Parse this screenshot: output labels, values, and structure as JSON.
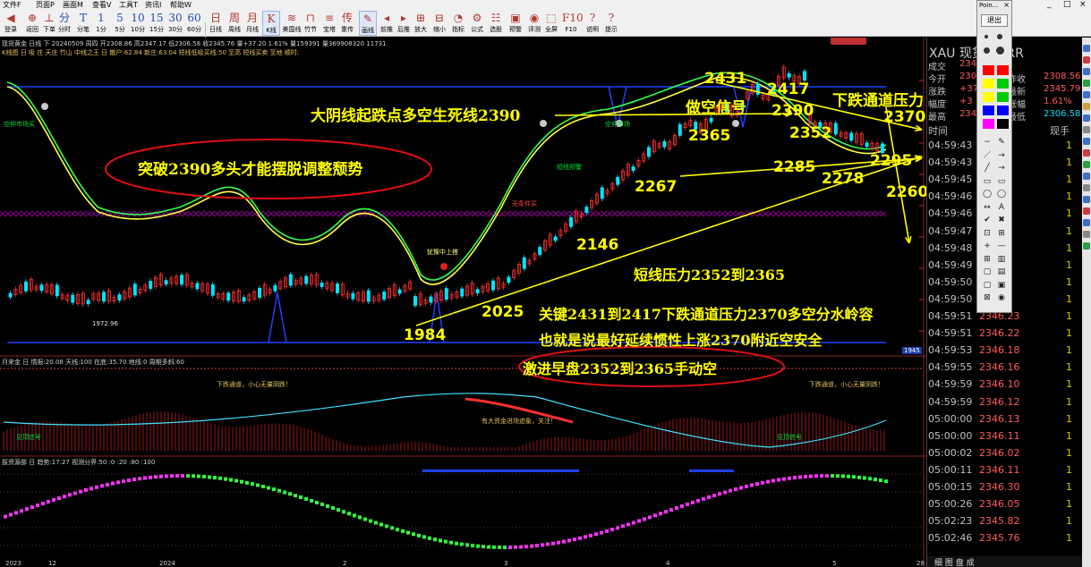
{
  "menu": {
    "items": [
      "文件F",
      "页面P",
      "画面M",
      "查看V",
      "工具T",
      "资讯I",
      "帮助W"
    ],
    "window_controls": [
      "_",
      "□",
      "×"
    ]
  },
  "toolbar": {
    "buttons": [
      {
        "glyph": "◀",
        "label": "登录"
      },
      {
        "glyph": "⊕",
        "label": "返回"
      },
      {
        "glyph": "⊥",
        "label": "下单"
      },
      {
        "glyph": "分",
        "label": "分时"
      },
      {
        "glyph": "T",
        "label": "分笔"
      },
      {
        "glyph": "1",
        "label": "1分"
      },
      {
        "glyph": "5",
        "label": "5分"
      },
      {
        "glyph": "10",
        "label": "10分"
      },
      {
        "glyph": "15",
        "label": "15分"
      },
      {
        "glyph": "30",
        "label": "30分"
      },
      {
        "glyph": "60",
        "label": "60分"
      },
      {
        "glyph": "日",
        "label": "日线"
      },
      {
        "glyph": "周",
        "label": "周线"
      },
      {
        "glyph": "月",
        "label": "月线"
      },
      {
        "glyph": "K",
        "label": "K线"
      },
      {
        "glyph": "≋",
        "label": "美国线"
      },
      {
        "glyph": "⊓",
        "label": "竹节"
      },
      {
        "glyph": "≡",
        "label": "宝塔"
      },
      {
        "glyph": "传",
        "label": "重传"
      },
      {
        "glyph": "✎",
        "label": "画线"
      },
      {
        "glyph": "◂",
        "label": "前推"
      },
      {
        "glyph": "▸",
        "label": "后推"
      },
      {
        "glyph": "⊞",
        "label": "放大"
      },
      {
        "glyph": "⊟",
        "label": "缩小"
      },
      {
        "glyph": "◔",
        "label": "指标"
      },
      {
        "glyph": "⚙",
        "label": "公式"
      },
      {
        "glyph": "☷",
        "label": "选股"
      },
      {
        "glyph": "▣",
        "label": "预警"
      },
      {
        "glyph": "◉",
        "label": "评测"
      },
      {
        "glyph": "⬚",
        "label": "全屏"
      },
      {
        "glyph": "F10",
        "label": "F10"
      },
      {
        "glyph": "?",
        "label": "说明"
      },
      {
        "glyph": "?",
        "label": "提示"
      }
    ]
  },
  "status": {
    "main": "现货黄金 日线 下 20240509 周四 开2308.86 高2347.17 低2306.58 收2345.76 量+37.20 1.61% 量159391 量369908320 11731",
    "indicator_line": "K线图 日 吸 庄 天庄 竹山 中线之王 日 散户:62.84 新庄:63.04 短线低吸买线:50 至高 短线买卖 至地 顺时:",
    "sub1": "月来金 日 情报:20.08 天线:100 在底:35.70 地线:0 周期多斜:60",
    "sub2": "拔资源部 日 趋势:17.27 视测分界:50 :0 :20 :80 :100"
  },
  "annotations": {
    "top_left": "大阴线起跌点多空生死线2390",
    "short_signal": "做空信号",
    "channel": "下跌通道压力",
    "breakout": "突破2390多头才能摆脱调整颓势",
    "short_pressure": "短线压力2352到2365",
    "key": "关键2431到2417下跌通道压力2370多空分水岭容",
    "inertia": "也就是说最好延续惯性上涨2370附近空安全",
    "aggressive": "激进早盘2352到2365手动空",
    "lvl_2431": "2431",
    "lvl_2417": "2417",
    "lvl_2390": "2390",
    "lvl_2370": "2370",
    "lvl_2365": "2365",
    "lvl_2352": "2352",
    "lvl_2285": "2285",
    "lvl_2278": "2278",
    "lvl_2295": "2295",
    "lvl_2260": "2260",
    "lvl_2267": "2267",
    "lvl_2146": "2146",
    "lvl_2025": "2025",
    "lvl_1984": "1984",
    "low_mark": "1972.96",
    "tag_right": "1945",
    "tags": {
      "a": "空仲市场买",
      "b": "空仲市场",
      "c": "短线预警",
      "d": "犹豫中上搭",
      "e": "无条件买",
      "f": "下跌通道，小心无量阴跌！",
      "g": "下跌通道，小心无量阴跌！",
      "h": "有大资金进场迹象，关注！",
      "i": "见顶信号",
      "j": "见顶信号"
    }
  },
  "axis": {
    "bottom": [
      "2023",
      "12",
      "2024",
      "2",
      "3",
      "4",
      "5"
    ],
    "right_bottom": "28"
  },
  "quote": {
    "symbol": "XAU 现货 CURR",
    "rows": [
      {
        "k": "成交",
        "v": "234"
      },
      {
        "k": "今开",
        "v": "230",
        "k2": "昨收",
        "v2": "2308.56"
      },
      {
        "k": "涨跌",
        "v": "+37",
        "k2": "最新",
        "v2": "2345.79"
      },
      {
        "k": "幅度",
        "v": "+3",
        "k2": "涨幅",
        "v2": "1.61%"
      },
      {
        "k": "最高",
        "v": "234",
        "k2": "最低",
        "v2": "2306.58"
      }
    ],
    "tick_header": {
      "time": "时间",
      "vol": "现手"
    },
    "ticks": [
      {
        "time": "04:59:43",
        "price": "",
        "vol": "1"
      },
      {
        "time": "04:59:43",
        "price": "",
        "vol": "1"
      },
      {
        "time": "04:59:45",
        "price": "",
        "vol": "1"
      },
      {
        "time": "04:59:46",
        "price": "",
        "vol": "1"
      },
      {
        "time": "04:59:46",
        "price": "",
        "vol": "1"
      },
      {
        "time": "04:59:47",
        "price": "",
        "vol": "1"
      },
      {
        "time": "04:59:48",
        "price": "",
        "vol": "1"
      },
      {
        "time": "04:59:49",
        "price": "",
        "vol": "1"
      },
      {
        "time": "04:59:50",
        "price": "",
        "vol": "1"
      },
      {
        "time": "04:59:50",
        "price": "",
        "vol": "1"
      },
      {
        "time": "04:59:51",
        "price": "2346.23",
        "vol": "1"
      },
      {
        "time": "04:59:51",
        "price": "2346.22",
        "vol": "1"
      },
      {
        "time": "04:59:53",
        "price": "2346.18",
        "vol": "1"
      },
      {
        "time": "04:59:55",
        "price": "2346.16",
        "vol": "1"
      },
      {
        "time": "04:59:59",
        "price": "2346.10",
        "vol": "1"
      },
      {
        "time": "04:59:59",
        "price": "2346.12",
        "vol": "1"
      },
      {
        "time": "05:00:00",
        "price": "2346.13",
        "vol": "1"
      },
      {
        "time": "05:00:00",
        "price": "2346.11",
        "vol": "1"
      },
      {
        "time": "05:00:02",
        "price": "2346.02",
        "vol": "1"
      },
      {
        "time": "05:00:11",
        "price": "2346.11",
        "vol": "1"
      },
      {
        "time": "05:00:15",
        "price": "2346.30",
        "vol": "1"
      },
      {
        "time": "05:00:26",
        "price": "2346.05",
        "vol": "1"
      },
      {
        "time": "05:02:23",
        "price": "2345.82",
        "vol": "1"
      },
      {
        "time": "05:02:46",
        "price": "2345.76",
        "vol": "1"
      }
    ],
    "tabs": "细 图 盘 成"
  },
  "palette": {
    "title": "Poin...",
    "close": "×",
    "exit": "退出"
  },
  "colors": {
    "annotation": "#ffff00",
    "up": "#ff3030",
    "down": "#00e5ff",
    "magenta": "#ff00ff",
    "green": "#00ff40"
  }
}
